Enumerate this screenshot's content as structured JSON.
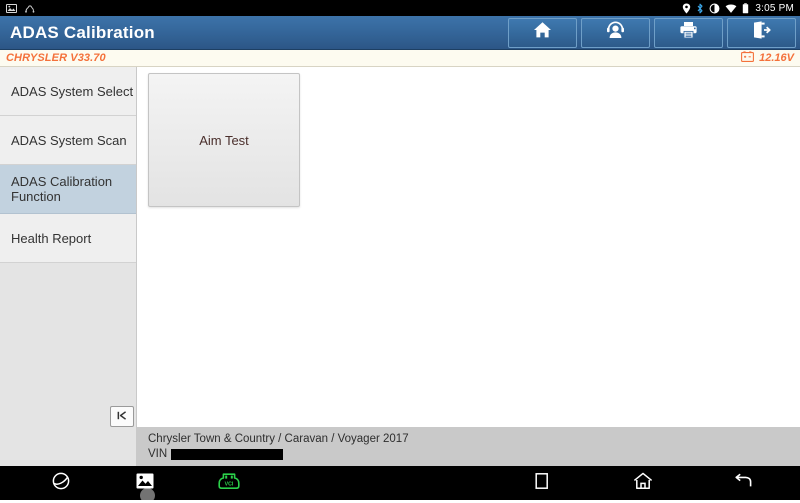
{
  "statusbar": {
    "left_icons": [
      "screenshot-icon",
      "usb-debug-icon"
    ],
    "right_icons": [
      "location-icon",
      "bluetooth-icon",
      "brightness-icon",
      "wifi-icon",
      "battery-icon"
    ],
    "clock": "3:05 PM"
  },
  "header": {
    "title": "ADAS Calibration",
    "buttons": [
      {
        "name": "home-button",
        "icon": "home-icon"
      },
      {
        "name": "support-button",
        "icon": "headset-person-icon"
      },
      {
        "name": "print-button",
        "icon": "printer-icon"
      },
      {
        "name": "exit-button",
        "icon": "exit-door-icon"
      }
    ]
  },
  "version_bar": {
    "vehicle_version": "CHRYSLER V33.70",
    "battery_icon": "car-battery-icon",
    "voltage": "12.16V",
    "accent_color": "#f4713b"
  },
  "sidebar": {
    "items": [
      {
        "label": "ADAS System Select",
        "selected": false
      },
      {
        "label": "ADAS System Scan",
        "selected": false
      },
      {
        "label": "ADAS Calibration Function",
        "selected": true
      },
      {
        "label": "Health Report",
        "selected": false
      }
    ],
    "selected_color": "#c2d2df",
    "collapse_button": {
      "icon": "collapse-left-icon"
    }
  },
  "main": {
    "tiles": [
      {
        "label": "Aim Test"
      }
    ]
  },
  "vehicle_info": {
    "model": "Chrysler Town & Country / Caravan / Voyager 2017",
    "vin_label": "VIN",
    "vin_value": ""
  },
  "navbar": {
    "left_buttons": [
      {
        "name": "browser-button",
        "icon": "globe-icon"
      },
      {
        "name": "gallery-button",
        "icon": "image-icon"
      },
      {
        "name": "vci-button",
        "icon": "vci-connector-icon",
        "color": "#2bd14a"
      }
    ],
    "right_buttons": [
      {
        "name": "recents-button",
        "icon": "square-icon"
      },
      {
        "name": "home-button",
        "icon": "house-icon"
      },
      {
        "name": "back-button",
        "icon": "back-arrow-icon"
      }
    ]
  }
}
